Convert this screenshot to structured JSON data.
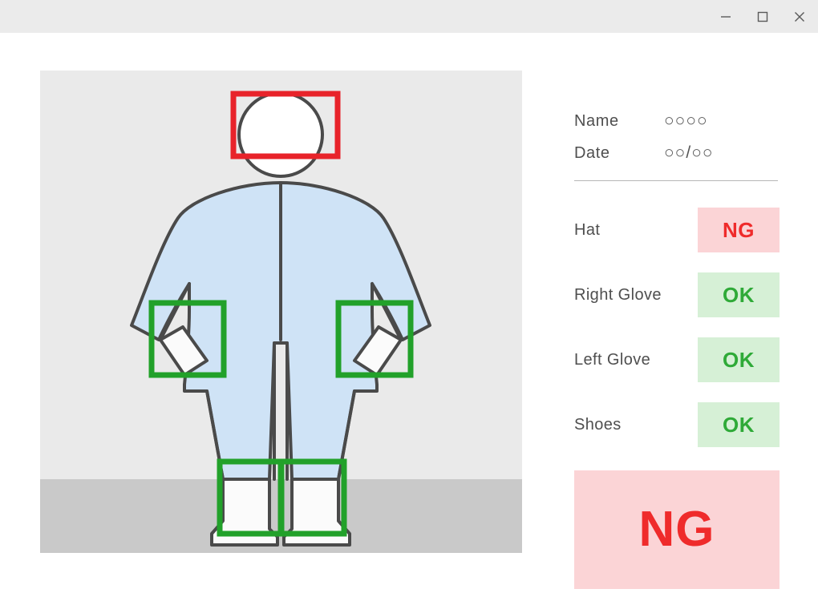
{
  "window": {
    "controls": [
      {
        "name": "minimize",
        "glyph": "minimize-icon"
      },
      {
        "name": "maximize",
        "glyph": "maximize-icon"
      },
      {
        "name": "close",
        "glyph": "close-icon"
      }
    ]
  },
  "meta": {
    "name_label": "Name",
    "name_value": "○○○○",
    "date_label": "Date",
    "date_value": "○○/○○"
  },
  "checks": [
    {
      "label": "Hat",
      "status": "NG"
    },
    {
      "label": "Right Glove",
      "status": "OK"
    },
    {
      "label": "Left Glove",
      "status": "OK"
    },
    {
      "label": "Shoes",
      "status": "OK"
    }
  ],
  "overall": {
    "status": "NG"
  },
  "colors": {
    "ok_text": "#2faa38",
    "ok_bg": "#d6f0d6",
    "ng_text": "#ef2b2b",
    "ng_bg": "#fbd4d6",
    "box_ok": "#22a12a",
    "box_ng": "#e8232a",
    "suit": "#cfe3f6",
    "outline": "#4a4a4a",
    "panel_bg": "#eaeaea",
    "floor": "#c9c9c9",
    "titlebar": "#ebebeb"
  },
  "figure": {
    "detection_boxes": [
      {
        "region": "hat",
        "status": "NG"
      },
      {
        "region": "right-glove",
        "status": "OK"
      },
      {
        "region": "left-glove",
        "status": "OK"
      },
      {
        "region": "right-shoe",
        "status": "OK"
      },
      {
        "region": "left-shoe",
        "status": "OK"
      }
    ]
  }
}
